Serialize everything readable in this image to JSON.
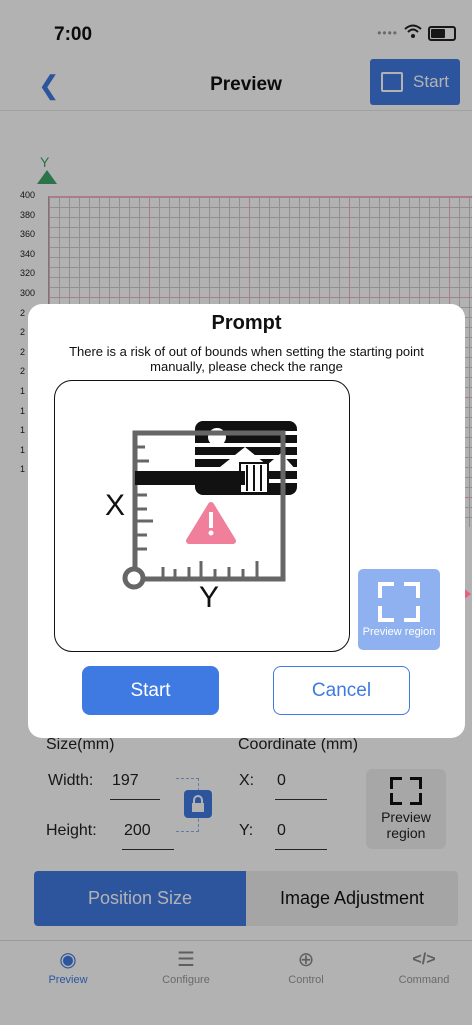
{
  "status": {
    "time": "7:00"
  },
  "nav": {
    "title": "Preview",
    "start_label": "Start"
  },
  "chart": {
    "axis_letter": "Y",
    "y_ticks": [
      "400",
      "380",
      "360",
      "340",
      "320",
      "300",
      "2",
      "2",
      "2",
      "2",
      "1",
      "1",
      "1",
      "1",
      "1"
    ]
  },
  "size_section": {
    "size_label": "Size(mm)",
    "coord_label": "Coordinate (mm)",
    "width_label": "Width:",
    "width_value": "197",
    "height_label": "Height:",
    "height_value": "200",
    "x_label": "X:",
    "x_value": "0",
    "y_label": "Y:",
    "y_value": "0",
    "preview_region_label": "Preview region"
  },
  "segments": {
    "position_size": "Position Size",
    "image_adjustment": "Image Adjustment"
  },
  "tabs": [
    {
      "label": "Preview",
      "icon": "eye-icon",
      "glyph": "◉"
    },
    {
      "label": "Configure",
      "icon": "sliders-icon",
      "glyph": "☰"
    },
    {
      "label": "Control",
      "icon": "crosshair-icon",
      "glyph": "⊕"
    },
    {
      "label": "Command",
      "icon": "code-icon",
      "glyph": "</>"
    }
  ],
  "dialog": {
    "title": "Prompt",
    "message": "There is a risk of out of bounds when setting the starting point manually, please check the range",
    "illus_x": "X",
    "illus_y": "Y",
    "preview_region": "Preview region",
    "start_label": "Start",
    "cancel_label": "Cancel"
  },
  "colors": {
    "accent": "#3f7ae3",
    "warning": "#ef7f9a",
    "axis_green": "#3ea66a"
  }
}
